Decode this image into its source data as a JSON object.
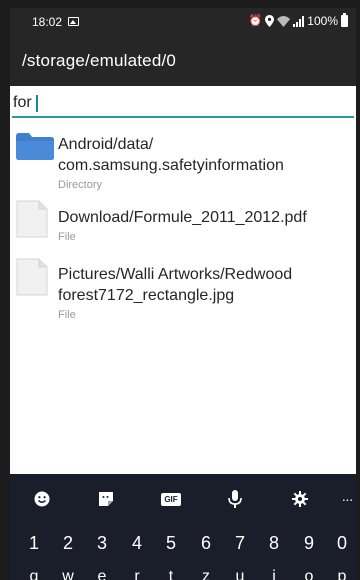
{
  "status_bar": {
    "time": "18:02",
    "battery_text": "100%",
    "icons": [
      "image-icon",
      "alarm-icon",
      "location-icon",
      "wifi-icon",
      "signal-icon",
      "battery-icon"
    ]
  },
  "app_bar": {
    "path": "/storage/emulated/0"
  },
  "search": {
    "value": "for"
  },
  "results": [
    {
      "icon": "folder-icon",
      "name_line1": "Android/data/",
      "name_line2": "com.samsung.safetyinformation",
      "kind": "Directory"
    },
    {
      "icon": "file-icon",
      "name_line1": "Download/Formule_2011_2012.pdf",
      "kind": "File"
    },
    {
      "icon": "file-icon",
      "name_line1": "Pictures/Walli Artworks/Redwood",
      "name_line2": "forest7172_rectangle.jpg",
      "kind": "File"
    }
  ],
  "keyboard": {
    "toolbar": [
      "emoji-icon",
      "sticker-icon",
      "gif-icon",
      "mic-icon",
      "settings-icon",
      "more-icon"
    ],
    "gif_label": "GIF",
    "more_label": "···",
    "number_row": [
      "1",
      "2",
      "3",
      "4",
      "5",
      "6",
      "7",
      "8",
      "9",
      "0"
    ],
    "letter_row": [
      "q",
      "w",
      "e",
      "r",
      "t",
      "z",
      "u",
      "i",
      "o",
      "p"
    ]
  },
  "colors": {
    "app_bar": "#262626",
    "accent": "#2a9a9a",
    "folder": "#3f7fd0",
    "keyboard_bg": "#1a1d2a"
  }
}
